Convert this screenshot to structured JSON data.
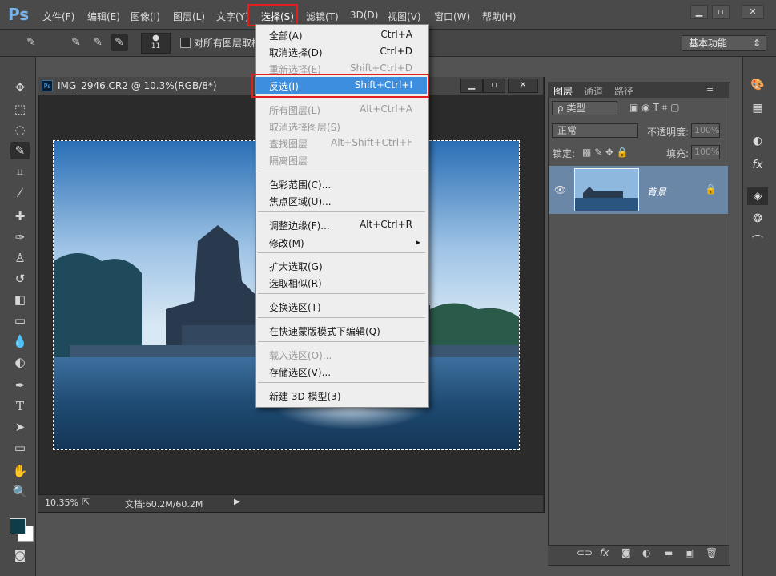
{
  "app": {
    "logo": "Ps"
  },
  "menubar": {
    "items": [
      {
        "label": "文件(F)"
      },
      {
        "label": "编辑(E)"
      },
      {
        "label": "图像(I)"
      },
      {
        "label": "图层(L)"
      },
      {
        "label": "文字(Y)"
      },
      {
        "label": "选择(S)"
      },
      {
        "label": "滤镜(T)"
      },
      {
        "label": "3D(D)"
      },
      {
        "label": "视图(V)"
      },
      {
        "label": "窗口(W)"
      },
      {
        "label": "帮助(H)"
      }
    ]
  },
  "options": {
    "brush_size": "11",
    "sample_all_label": "对所有图层取样",
    "workspace": "基本功能"
  },
  "document": {
    "title": "IMG_2946.CR2 @ 10.3%(RGB/8*)",
    "zoom": "10.35%",
    "doc_size": "文档:60.2M/60.2M"
  },
  "select_menu": {
    "items": [
      {
        "label": "全部(A)",
        "shortcut": "Ctrl+A"
      },
      {
        "label": "取消选择(D)",
        "shortcut": "Ctrl+D"
      },
      {
        "label": "重新选择(E)",
        "shortcut": "Shift+Ctrl+D"
      },
      {
        "label": "反选(I)",
        "shortcut": "Shift+Ctrl+I"
      },
      {
        "label": "所有图层(L)",
        "shortcut": "Alt+Ctrl+A"
      },
      {
        "label": "取消选择图层(S)",
        "shortcut": ""
      },
      {
        "label": "查找图层",
        "shortcut": "Alt+Shift+Ctrl+F"
      },
      {
        "label": "隔离图层",
        "shortcut": ""
      },
      {
        "label": "色彩范围(C)...",
        "shortcut": ""
      },
      {
        "label": "焦点区域(U)...",
        "shortcut": ""
      },
      {
        "label": "调整边缘(F)...",
        "shortcut": "Alt+Ctrl+R"
      },
      {
        "label": "修改(M)",
        "shortcut": "▸"
      },
      {
        "label": "扩大选取(G)",
        "shortcut": ""
      },
      {
        "label": "选取相似(R)",
        "shortcut": ""
      },
      {
        "label": "变换选区(T)",
        "shortcut": ""
      },
      {
        "label": "在快速蒙版模式下编辑(Q)",
        "shortcut": ""
      },
      {
        "label": "载入选区(O)...",
        "shortcut": ""
      },
      {
        "label": "存储选区(V)...",
        "shortcut": ""
      },
      {
        "label": "新建 3D 模型(3)",
        "shortcut": ""
      }
    ]
  },
  "layers_panel": {
    "tabs": [
      {
        "label": "图层"
      },
      {
        "label": "通道"
      },
      {
        "label": "路径"
      }
    ],
    "filter_kind": "ρ 类型",
    "blend_mode": "正常",
    "opacity_label": "不透明度:",
    "opacity_value": "100%",
    "lock_label": "锁定:",
    "fill_label": "填充:",
    "fill_value": "100%",
    "layer_name": "背景"
  },
  "colors": {
    "accent": "#3e8edf",
    "highlight_red": "#e21f1f",
    "foreground": "#0f3d47",
    "background": "#ffffff"
  }
}
